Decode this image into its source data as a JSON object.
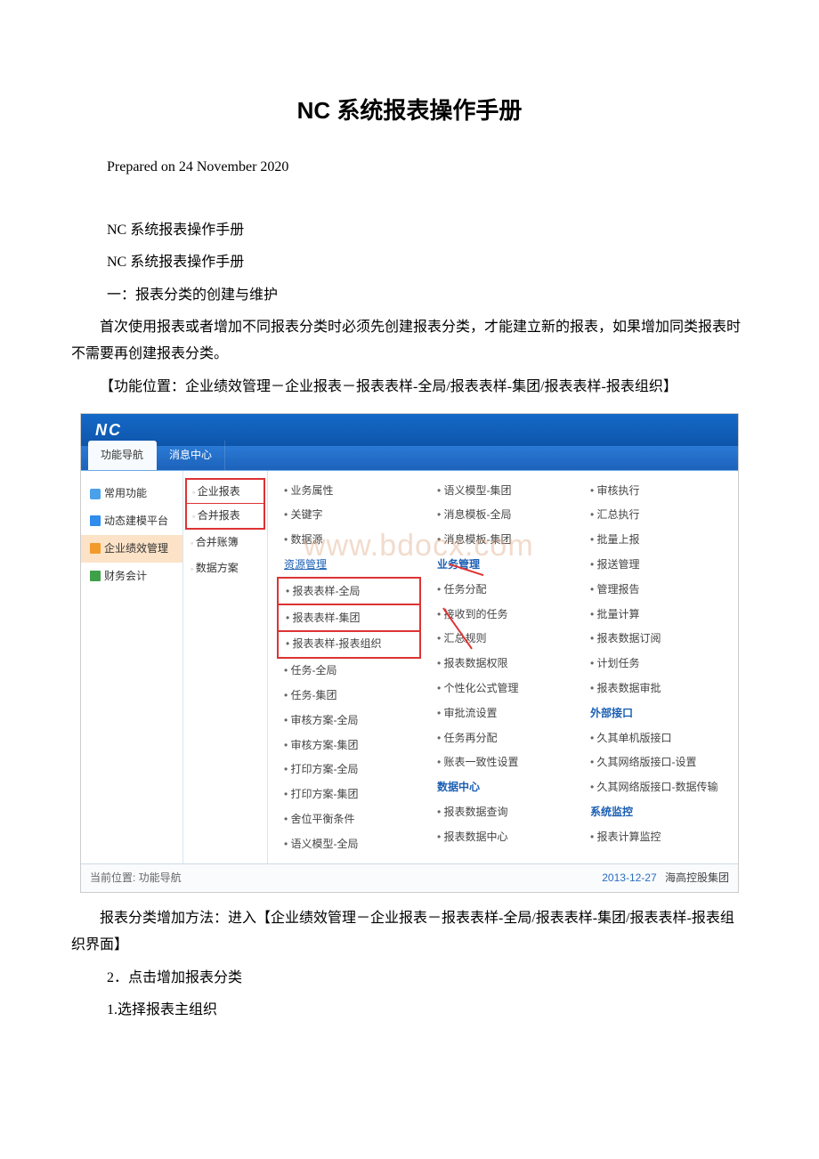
{
  "doc": {
    "title": "NC 系统报表操作手册",
    "prepared": "Prepared on 24 November 2020",
    "line1": "NC 系统报表操作手册",
    "line2": "NC 系统报表操作手册",
    "line3": "一：报表分类的创建与维护",
    "para1": "首次使用报表或者增加不同报表分类时必须先创建报表分类，才能建立新的报表，如果增加同类报表时不需要再创建报表分类。",
    "para2": "【功能位置：企业绩效管理－企业报表－报表表样-全局/报表表样-集团/报表表样-报表组织】",
    "para3": "报表分类增加方法：进入【企业绩效管理－企业报表－报表表样-全局/报表表样-集团/报表表样-报表组织界面】",
    "line4": "2．点击增加报表分类",
    "line5": "1.选择报表主组织"
  },
  "nc": {
    "logo": "NC",
    "tabs": {
      "t1": "功能导航",
      "t2": "消息中心"
    },
    "left": {
      "i1": "常用功能",
      "i2": "动态建模平台",
      "i3": "企业绩效管理",
      "i4": "财务会计"
    },
    "sub": {
      "s1": "企业报表",
      "s2": "合并报表",
      "s3": "合并账簿",
      "s4": "数据方案"
    },
    "col1": {
      "c1": "业务属性",
      "c2": "关键字",
      "c3": "数据源",
      "c4": "资源管理",
      "c5": "报表表样-全局",
      "c6": "报表表样-集团",
      "c7": "报表表样-报表组织",
      "c8": "任务-全局",
      "c9": "任务-集团",
      "c10": "审核方案-全局",
      "c11": "审核方案-集团",
      "c12": "打印方案-全局",
      "c13": "打印方案-集团",
      "c14": "舍位平衡条件",
      "c15": "语义模型-全局"
    },
    "col2": {
      "c1": "语义模型-集团",
      "c2": "消息模板-全局",
      "c3": "消息模板-集团",
      "c4": "业务管理",
      "c5": "任务分配",
      "c6": "接收到的任务",
      "c7": "汇总规则",
      "c8": "报表数据权限",
      "c9": "个性化公式管理",
      "c10": "审批流设置",
      "c11": "任务再分配",
      "c12": "账表一致性设置",
      "c13": "数据中心",
      "c14": "报表数据查询",
      "c15": "报表数据中心"
    },
    "col3": {
      "c1": "审核执行",
      "c2": "汇总执行",
      "c3": "批量上报",
      "c4": "报送管理",
      "c5": "管理报告",
      "c6": "批量计算",
      "c7": "报表数据订阅",
      "c8": "计划任务",
      "c9": "报表数据审批",
      "c10": "外部接口",
      "c11": "久其单机版接口",
      "c12": "久其网络版接口-设置",
      "c13": "久其网络版接口-数据传输",
      "c14": "系统监控",
      "c15": "报表计算监控"
    },
    "status": {
      "left": "当前位置: 功能导航",
      "date": "2013-12-27",
      "org": "海高控股集团"
    },
    "watermark": "www.bdocx.com"
  }
}
